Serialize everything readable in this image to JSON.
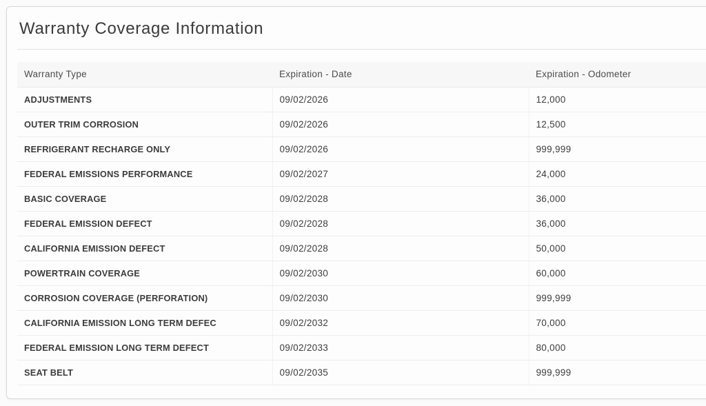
{
  "page": {
    "title": "Warranty Coverage Information"
  },
  "table": {
    "columns": [
      "Warranty Type",
      "Expiration - Date",
      "Expiration - Odometer"
    ],
    "rows": [
      {
        "warranty_type": "ADJUSTMENTS",
        "expiration_date": "09/02/2026",
        "expiration_odometer": "12,000"
      },
      {
        "warranty_type": "OUTER TRIM CORROSION",
        "expiration_date": "09/02/2026",
        "expiration_odometer": "12,500"
      },
      {
        "warranty_type": "REFRIGERANT RECHARGE ONLY",
        "expiration_date": "09/02/2026",
        "expiration_odometer": "999,999"
      },
      {
        "warranty_type": "FEDERAL EMISSIONS PERFORMANCE",
        "expiration_date": "09/02/2027",
        "expiration_odometer": "24,000"
      },
      {
        "warranty_type": "BASIC COVERAGE",
        "expiration_date": "09/02/2028",
        "expiration_odometer": "36,000"
      },
      {
        "warranty_type": "FEDERAL EMISSION DEFECT",
        "expiration_date": "09/02/2028",
        "expiration_odometer": "36,000"
      },
      {
        "warranty_type": "CALIFORNIA EMISSION DEFECT",
        "expiration_date": "09/02/2028",
        "expiration_odometer": "50,000"
      },
      {
        "warranty_type": "POWERTRAIN COVERAGE",
        "expiration_date": "09/02/2030",
        "expiration_odometer": "60,000"
      },
      {
        "warranty_type": "CORROSION COVERAGE (PERFORATION)",
        "expiration_date": "09/02/2030",
        "expiration_odometer": "999,999"
      },
      {
        "warranty_type": "CALIFORNIA EMISSION LONG TERM DEFEC",
        "expiration_date": "09/02/2032",
        "expiration_odometer": "70,000"
      },
      {
        "warranty_type": "FEDERAL EMISSION LONG TERM DEFECT",
        "expiration_date": "09/02/2033",
        "expiration_odometer": "80,000"
      },
      {
        "warranty_type": "SEAT BELT",
        "expiration_date": "09/02/2035",
        "expiration_odometer": "999,999"
      }
    ]
  }
}
